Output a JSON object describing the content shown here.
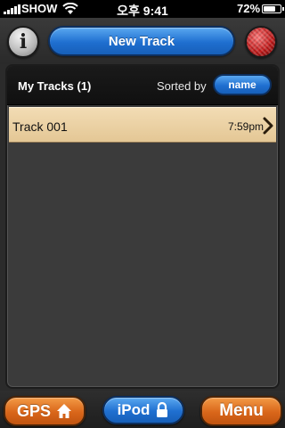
{
  "status_bar": {
    "carrier": "SHOW",
    "time": "오후 9:41",
    "battery_percent": "72%",
    "battery_level": 0.72,
    "signal_bars": 5,
    "wifi_icon": "wifi-icon"
  },
  "top_bar": {
    "info_label": "i",
    "new_track_label": "New Track",
    "record_icon": "record-icon"
  },
  "list_header": {
    "title": "My Tracks (1)",
    "sorted_by_label": "Sorted by",
    "sort_value": "name"
  },
  "tracks": [
    {
      "name": "Track 001",
      "time": "7:59pm"
    }
  ],
  "bottom_bar": {
    "gps_label": "GPS",
    "ipod_label": "iPod",
    "menu_label": "Menu"
  },
  "colors": {
    "accent_blue": "#1f6fd0",
    "accent_orange": "#d9661a",
    "row_bg": "#e4c795"
  }
}
